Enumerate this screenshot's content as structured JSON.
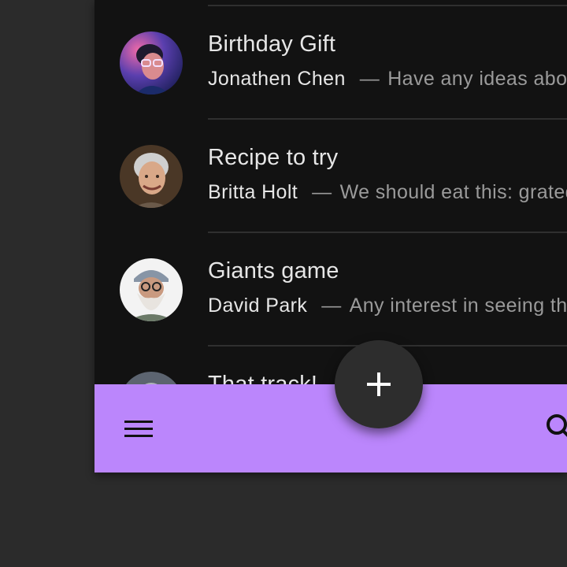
{
  "colors": {
    "background": "#2b2b2b",
    "surface": "#121212",
    "primary": "#bb86fc",
    "fab": "#2d2d2d",
    "text_primary": "#e6e6e6",
    "text_secondary": "#9a9a9a"
  },
  "inbox": {
    "items": [
      {
        "title": "Birthday Gift",
        "sender": "Jonathen Chen",
        "separator": "—",
        "preview": "Have any ideas about what we should get Heidi for her birthday?",
        "avatar": "avatar-photo-jonathen"
      },
      {
        "title": "Recipe to try",
        "sender": "Britta Holt",
        "separator": "—",
        "preview": "We should eat this: grated squash. Corn and tomatillo tacos.",
        "avatar": "avatar-photo-britta"
      },
      {
        "title": "Giants game",
        "sender": "David Park",
        "separator": "—",
        "preview": "Any interest in seeing the Giants game tonight?",
        "avatar": "avatar-photo-david"
      },
      {
        "title": "That track!",
        "avatar": "avatar-photo-partial"
      }
    ]
  },
  "bottom_app_bar": {
    "menu_icon": "menu-icon",
    "search_icon": "search-icon"
  },
  "fab": {
    "icon": "plus-icon"
  }
}
